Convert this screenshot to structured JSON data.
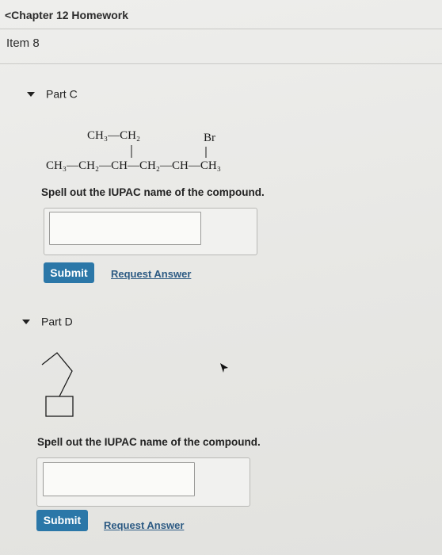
{
  "header": {
    "back_label": "<Chapter 12 Homework",
    "item_title": "Item 8"
  },
  "partC": {
    "label": "Part C",
    "formula": {
      "branch": "CH₃—CH₂",
      "substituent": "Br",
      "main_chain": "CH₃—CH₂—CH—CH₂—CH—CH₃"
    },
    "prompt": "Spell out the IUPAC name of the compound.",
    "answer_value": "",
    "submit_label": "Submit",
    "request_label": "Request Answer"
  },
  "partD": {
    "label": "Part D",
    "prompt": "Spell out the IUPAC name of the compound.",
    "answer_value": "",
    "submit_label": "Submit",
    "request_label": "Request Answer"
  },
  "icons": {
    "collapse": "caret-down-icon",
    "pointer": "mouse-pointer-icon"
  }
}
